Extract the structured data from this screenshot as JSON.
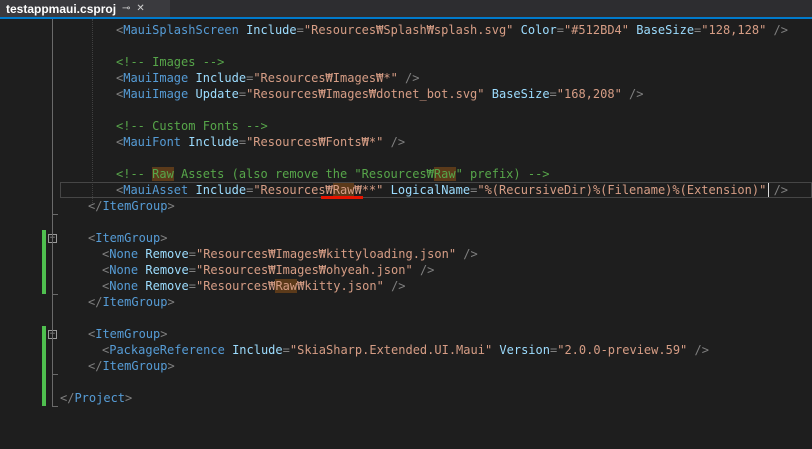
{
  "tab": {
    "title": "testappmaui.csproj",
    "pin_icon": "pin-icon",
    "close_icon": "close-icon"
  },
  "code": {
    "l1": {
      "tag": "MauiSplashScreen",
      "a1": "Include",
      "v1": "\"Resources₩Splash₩splash.svg\"",
      "a2": "Color",
      "v2": "\"#512BD4\"",
      "a3": "BaseSize",
      "v3": "\"128,128\""
    },
    "l3": {
      "comment": "<!-- Images -->"
    },
    "l4": {
      "tag": "MauiImage",
      "a1": "Include",
      "v1": "\"Resources₩Images₩*\""
    },
    "l5": {
      "tag": "MauiImage",
      "a1": "Update",
      "v1": "\"Resources₩Images₩dotnet_bot.svg\"",
      "a2": "BaseSize",
      "v2": "\"168,208\""
    },
    "l7": {
      "comment": "<!-- Custom Fonts -->"
    },
    "l8": {
      "tag": "MauiFont",
      "a1": "Include",
      "v1": "\"Resources₩Fonts₩*\""
    },
    "l10": {
      "c1": "<!-- ",
      "hl1": "Raw",
      "c2": " Assets (also remove the \"Resources₩",
      "hl2": "Raw",
      "c3": "\" prefix) -->"
    },
    "l11": {
      "tag": "MauiAsset",
      "a1": "Include",
      "v1a": "\"Resources₩",
      "v1b": "Raw",
      "v1c": "₩**\"",
      "a2": "LogicalName",
      "v2": "\"%(RecursiveDir)%(Filename)%(Extension)\""
    },
    "l12": {
      "tag": "ItemGroup"
    },
    "l14": {
      "tag": "ItemGroup"
    },
    "l15": {
      "tag": "None",
      "a1": "Remove",
      "v1": "\"Resources₩Images₩kittyloading.json\""
    },
    "l16": {
      "tag": "None",
      "a1": "Remove",
      "v1": "\"Resources₩Images₩ohyeah.json\""
    },
    "l17": {
      "tag": "None",
      "a1": "Remove",
      "v1a": "\"Resources₩",
      "v1b": "Raw",
      "v1c": "₩kitty.json\""
    },
    "l18": {
      "tag": "ItemGroup"
    },
    "l20": {
      "tag": "ItemGroup"
    },
    "l21": {
      "tag": "PackageReference",
      "a1": "Include",
      "v1": "\"SkiaSharp.Extended.UI.Maui\"",
      "a2": "Version",
      "v2": "\"2.0.0-preview.59\""
    },
    "l22": {
      "tag": "ItemGroup"
    },
    "l24": {
      "tag": "Project"
    }
  },
  "colors": {
    "accent": "#007acc",
    "change_bar": "#4fbf4f",
    "error_squiggle": "#e51400",
    "tag": "#569cd6",
    "attribute": "#9cdcfe",
    "string": "#d69d85",
    "comment": "#57a64a"
  }
}
